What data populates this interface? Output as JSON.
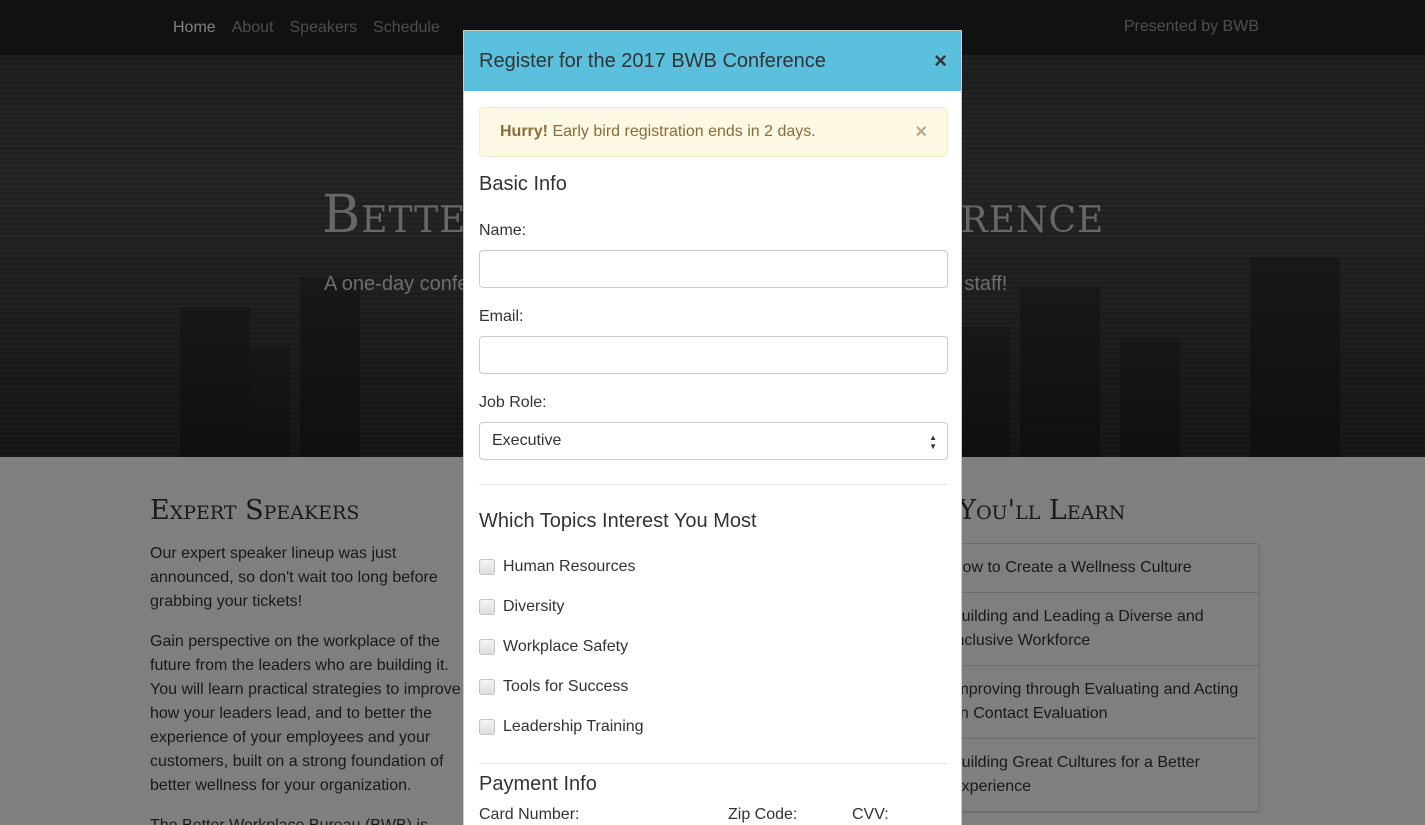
{
  "navbar": {
    "links": [
      {
        "label": "Home",
        "active": true
      },
      {
        "label": "About"
      },
      {
        "label": "Speakers"
      },
      {
        "label": "Schedule"
      }
    ],
    "right_text": "Presented by BWB"
  },
  "hero": {
    "title": "Better Workplace Conference",
    "subtitle": "A one-day conference for improving the workplace for management and staff!"
  },
  "speakers": {
    "heading": "Expert Speakers",
    "paragraphs": [
      "Our expert speaker lineup was just announced, so don't wait too long before grabbing your tickets!",
      "Gain perspective on the workplace of the future from the leaders who are building it. You will learn practical strategies to improve how your leaders lead, and to better the experience of your employees and your customers, built on a strong foundation of better wellness for your organization.",
      "The Better Workplace Bureau (BWB) is"
    ]
  },
  "learn": {
    "heading": "What You'll Learn",
    "items": [
      "How to Create a Wellness Culture",
      "Building and Leading a Diverse and Inclusive Workforce",
      "Improving through Evaluating and Acting on Contact Evaluation",
      "Building Great Cultures for a Better Experience"
    ]
  },
  "modal": {
    "title": "Register for the 2017 BWB Conference",
    "close": "×",
    "alert": {
      "strong": "Hurry!",
      "text": " Early bird registration ends in 2 days.",
      "close": "×"
    },
    "basic_info_heading": "Basic Info",
    "name_label": "Name:",
    "name_value": "",
    "email_label": "Email:",
    "email_value": "",
    "job_role_label": "Job Role:",
    "job_role_value": "Executive",
    "topics_heading": "Which Topics Interest You Most",
    "topics": [
      "Human Resources",
      "Diversity",
      "Workplace Safety",
      "Tools for Success",
      "Leadership Training"
    ],
    "payment_heading": "Payment Info",
    "card_number_label": "Card Number:",
    "zip_label": "Zip Code:",
    "cvv_label": "CVV:"
  },
  "colors": {
    "modal_header": "#5bc0de",
    "alert_bg": "#fcf8e3",
    "navbar": "#222222"
  }
}
